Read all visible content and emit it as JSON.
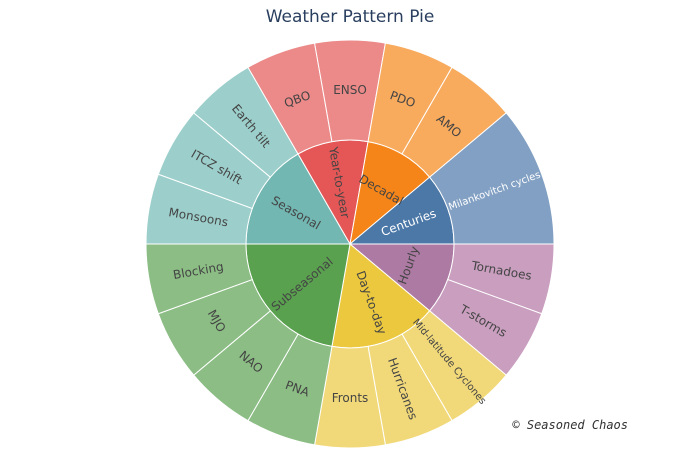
{
  "chart_data": {
    "type": "sunburst",
    "title": "Weather Pattern Pie",
    "credit": "© Seasoned Chaos",
    "inner": [
      {
        "label": "Hourly",
        "value": 2,
        "color": "#ad7aa3",
        "text_color": "#444444"
      },
      {
        "label": "Day-to-day",
        "value": 3,
        "color": "#ecc83e",
        "text_color": "#444444"
      },
      {
        "label": "Subseasonal",
        "value": 4,
        "color": "#5aa14f",
        "text_color": "#444444"
      },
      {
        "label": "Seasonal",
        "value": 3,
        "color": "#72b7b2",
        "text_color": "#444444"
      },
      {
        "label": "Year-to-year",
        "value": 2,
        "color": "#e45756",
        "text_color": "#444444"
      },
      {
        "label": "Decadal",
        "value": 2,
        "color": "#f58518",
        "text_color": "#444444"
      },
      {
        "label": "Centuries",
        "value": 2,
        "color": "#4c78a8",
        "text_color": "#ffffff"
      }
    ],
    "outer": [
      {
        "label": "Tornadoes",
        "parent": "Hourly",
        "value": 1,
        "color": "#c99ebf",
        "text_color": "#444444"
      },
      {
        "label": "T-storms",
        "parent": "Hourly",
        "value": 1,
        "color": "#c99ebf",
        "text_color": "#444444"
      },
      {
        "label": "Mid-latitude Cyclones",
        "parent": "Day-to-day",
        "value": 1,
        "color": "#f1d97a",
        "text_color": "#444444"
      },
      {
        "label": "Hurricanes",
        "parent": "Day-to-day",
        "value": 1,
        "color": "#f1d97a",
        "text_color": "#444444"
      },
      {
        "label": "Fronts",
        "parent": "Day-to-day",
        "value": 1,
        "color": "#f1d97a",
        "text_color": "#444444"
      },
      {
        "label": "PNA",
        "parent": "Subseasonal",
        "value": 1,
        "color": "#8bbd84",
        "text_color": "#444444"
      },
      {
        "label": "NAO",
        "parent": "Subseasonal",
        "value": 1,
        "color": "#8bbd84",
        "text_color": "#444444"
      },
      {
        "label": "MJO",
        "parent": "Subseasonal",
        "value": 1,
        "color": "#8bbd84",
        "text_color": "#444444"
      },
      {
        "label": "Blocking",
        "parent": "Subseasonal",
        "value": 1,
        "color": "#8bbd84",
        "text_color": "#444444"
      },
      {
        "label": "Monsoons",
        "parent": "Seasonal",
        "value": 1,
        "color": "#9ccfcb",
        "text_color": "#444444"
      },
      {
        "label": "ITCZ shift",
        "parent": "Seasonal",
        "value": 1,
        "color": "#9ccfcb",
        "text_color": "#444444"
      },
      {
        "label": "Earth tilt",
        "parent": "Seasonal",
        "value": 1,
        "color": "#9ccfcb",
        "text_color": "#444444"
      },
      {
        "label": "QBO",
        "parent": "Year-to-year",
        "value": 1,
        "color": "#ec8a89",
        "text_color": "#444444"
      },
      {
        "label": "ENSO",
        "parent": "Year-to-year",
        "value": 1,
        "color": "#ec8a89",
        "text_color": "#444444"
      },
      {
        "label": "PDO",
        "parent": "Decadal",
        "value": 1,
        "color": "#f8aa5d",
        "text_color": "#444444"
      },
      {
        "label": "AMO",
        "parent": "Decadal",
        "value": 1,
        "color": "#f8aa5d",
        "text_color": "#444444"
      },
      {
        "label": "Milankovitch cycles",
        "parent": "Centuries",
        "value": 2,
        "color": "#82a0c3",
        "text_color": "#ffffff"
      }
    ]
  }
}
